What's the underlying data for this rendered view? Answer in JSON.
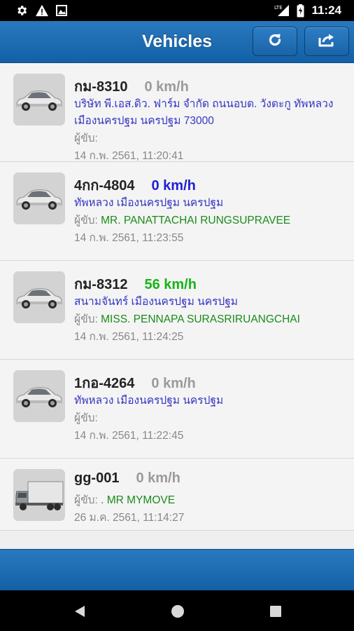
{
  "status_bar": {
    "time": "11:24",
    "left_icons": [
      "gear-icon",
      "warning-icon",
      "image-icon"
    ],
    "right_icons": [
      "lte-signal-icon",
      "battery-icon"
    ]
  },
  "header": {
    "title": "Vehicles",
    "buttons": [
      "refresh-icon",
      "share-icon"
    ],
    "color": "#1a67ad"
  },
  "vehicles": [
    {
      "plate": "กม-8310",
      "speed": "0 km/h",
      "speed_color": "#9a9a9a",
      "address": "บริษัท พี.เอส.ดิว. ฟาร์ม จำกัด ถนนอบต. วังตะกู ทัพหลวง เมืองนครปฐม นครปฐม 73000",
      "driver_label": "ผู้ขับ:",
      "driver_name": "",
      "timestamp": "14 ก.พ. 2561, 11:20:41",
      "icon": "car-icon"
    },
    {
      "plate": "4กก-4804",
      "speed": "0 km/h",
      "speed_color": "#1f1fd6",
      "address": "ทัพหลวง เมืองนครปฐม นครปฐม",
      "driver_label": "ผู้ขับ:",
      "driver_name": "MR. PANATTACHAI RUNGSUPRAVEE",
      "timestamp": "14 ก.พ. 2561, 11:23:55",
      "icon": "car-icon"
    },
    {
      "plate": "กม-8312",
      "speed": "56 km/h",
      "speed_color": "#17b417",
      "address": "สนามจันทร์ เมืองนครปฐม นครปฐม",
      "driver_label": "ผู้ขับ:",
      "driver_name": "MISS. PENNAPA SURASRIRUANGCHAI",
      "timestamp": "14 ก.พ. 2561, 11:24:25",
      "icon": "car-icon"
    },
    {
      "plate": "1กอ-4264",
      "speed": "0 km/h",
      "speed_color": "#9a9a9a",
      "address": "ทัพหลวง เมืองนครปฐม นครปฐม",
      "driver_label": "ผู้ขับ:",
      "driver_name": "",
      "timestamp": "14 ก.พ. 2561, 11:22:45",
      "icon": "car-icon"
    },
    {
      "plate": "gg-001",
      "speed": "0 km/h",
      "speed_color": "#9a9a9a",
      "address": "",
      "driver_label": "ผู้ขับ:",
      "driver_name": ". MR MYMOVE",
      "timestamp": "26 ม.ค. 2561, 11:14:27",
      "icon": "truck-icon"
    }
  ],
  "nav_bar": {
    "buttons": [
      "back-icon",
      "home-icon",
      "recents-icon"
    ]
  }
}
